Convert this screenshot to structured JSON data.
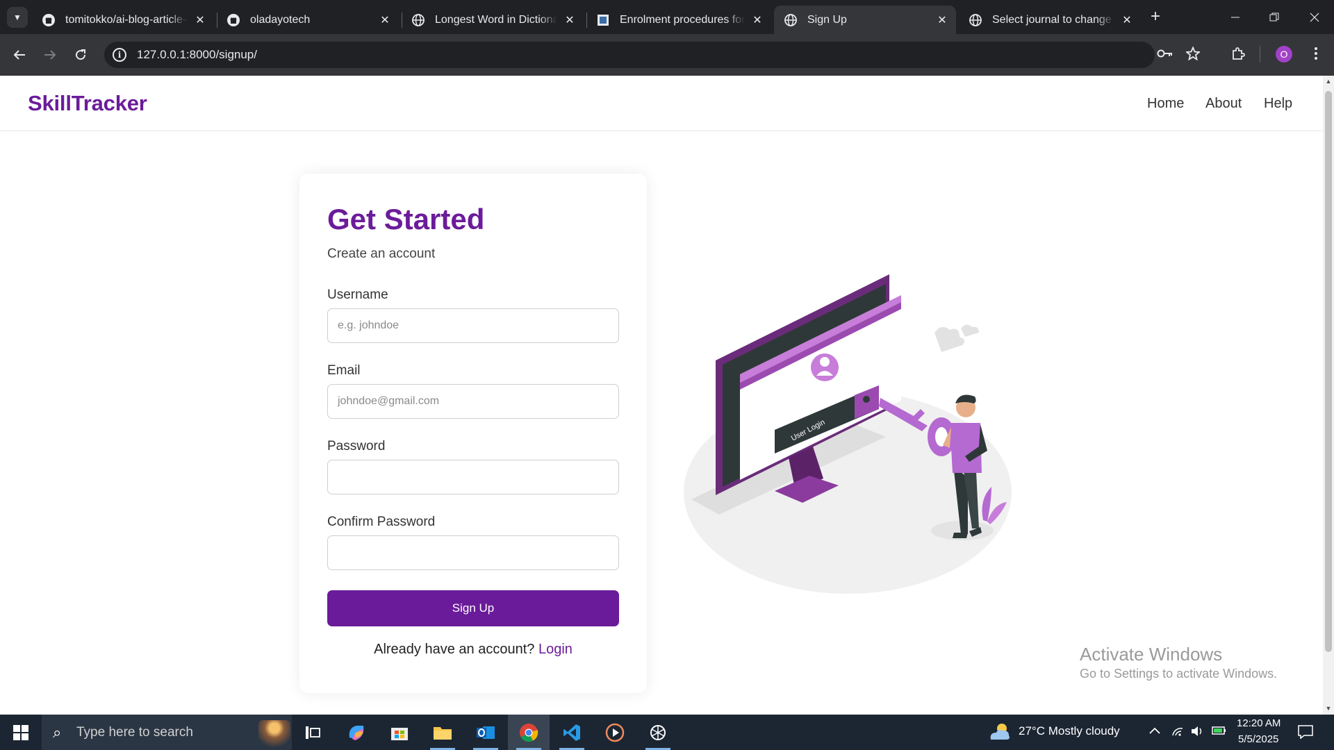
{
  "browser": {
    "tabs": [
      {
        "title": "tomitokko/ai-blog-article-generator",
        "icon": "github-icon",
        "active": false
      },
      {
        "title": "oladayotech",
        "icon": "github-icon",
        "active": false
      },
      {
        "title": "Longest Word in Dictionary",
        "icon": "globe-icon",
        "active": false
      },
      {
        "title": "Enrolment procedures for University",
        "icon": "doc-favicon-icon",
        "active": false
      },
      {
        "title": "Sign Up",
        "icon": "globe-icon",
        "active": true
      },
      {
        "title": "Select journal to change | Django",
        "icon": "globe-icon",
        "active": false
      }
    ],
    "url": "127.0.0.1:8000/signup/",
    "profile_initial": "O"
  },
  "site": {
    "brand": "SkillTracker",
    "nav": [
      "Home",
      "About",
      "Help"
    ],
    "brand_color": "#6b1c9a"
  },
  "form": {
    "title": "Get Started",
    "subtitle": "Create an account",
    "username_label": "Username",
    "username_placeholder": "e.g. johndoe",
    "email_label": "Email",
    "email_placeholder": "johndoe@gmail.com",
    "password_label": "Password",
    "confirm_label": "Confirm Password",
    "submit": "Sign Up",
    "login_prompt": "Already have an account?",
    "login_link": "Login",
    "accent": "#6a1b9a"
  },
  "illustration": {
    "screen_text": "User Login"
  },
  "watermark": {
    "title": "Activate Windows",
    "subtitle": "Go to Settings to activate Windows."
  },
  "taskbar": {
    "search_placeholder": "Type here to search",
    "weather": "27°C  Mostly cloudy",
    "time": "12:20 AM",
    "date": "5/5/2025"
  }
}
